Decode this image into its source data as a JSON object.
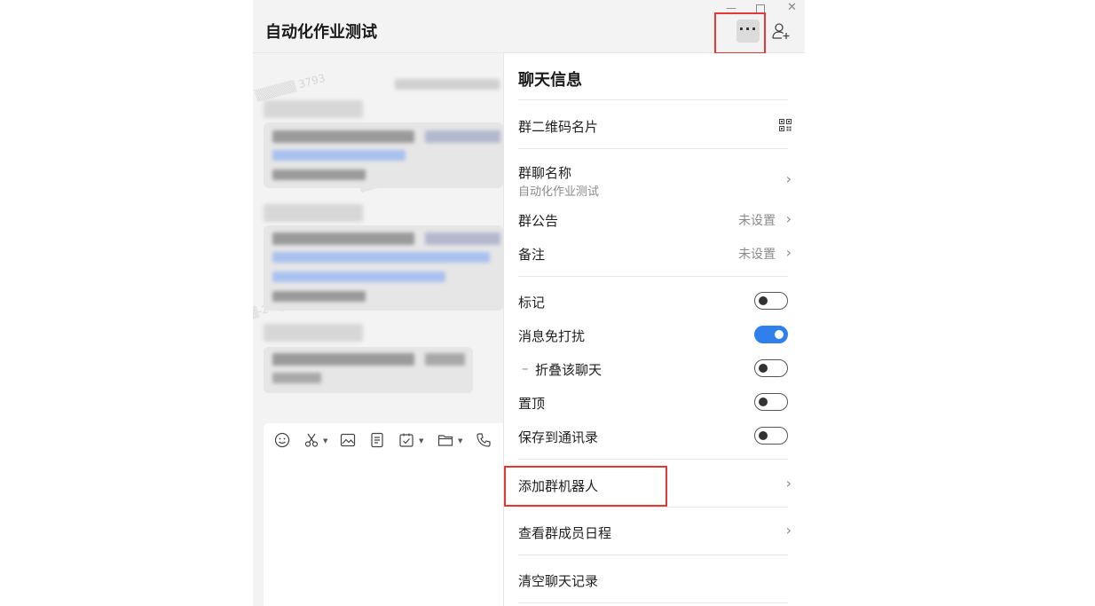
{
  "window": {
    "chat_title": "自动化作业测试",
    "controls": {
      "minimize": "—",
      "close": "✕"
    },
    "more_label": "···"
  },
  "panel": {
    "title": "聊天信息",
    "rows": [
      {
        "label": "群二维码名片",
        "icon": "qr-code-icon"
      },
      {
        "label": "群聊名称",
        "sub": "自动化作业测试",
        "chevron": "›"
      },
      {
        "label": "群公告",
        "value": "未设置",
        "chevron": "›"
      },
      {
        "label": "备注",
        "value": "未设置",
        "chevron": "›"
      }
    ],
    "toggles": [
      {
        "label": "标记",
        "on": false
      },
      {
        "label": "消息免打扰",
        "on": true
      },
      {
        "label": "折叠该聊天",
        "prefix": "–",
        "on": false
      },
      {
        "label": "置顶",
        "on": false
      },
      {
        "label": "保存到通讯录",
        "on": false
      }
    ],
    "actions": [
      {
        "label": "添加群机器人",
        "chevron": "›"
      },
      {
        "label": "查看群成员日程",
        "chevron": "›"
      },
      {
        "label": "清空聊天记录"
      }
    ]
  },
  "composer_tools": [
    "emoji-icon",
    "scissors-icon",
    "image-icon",
    "document-icon",
    "task-icon",
    "folder-icon",
    "phone-icon"
  ],
  "colors": {
    "accent": "#2f7fec",
    "highlight": "#e53935",
    "panel_bg": "#ffffff",
    "window_bg": "#f3f3f3"
  }
}
